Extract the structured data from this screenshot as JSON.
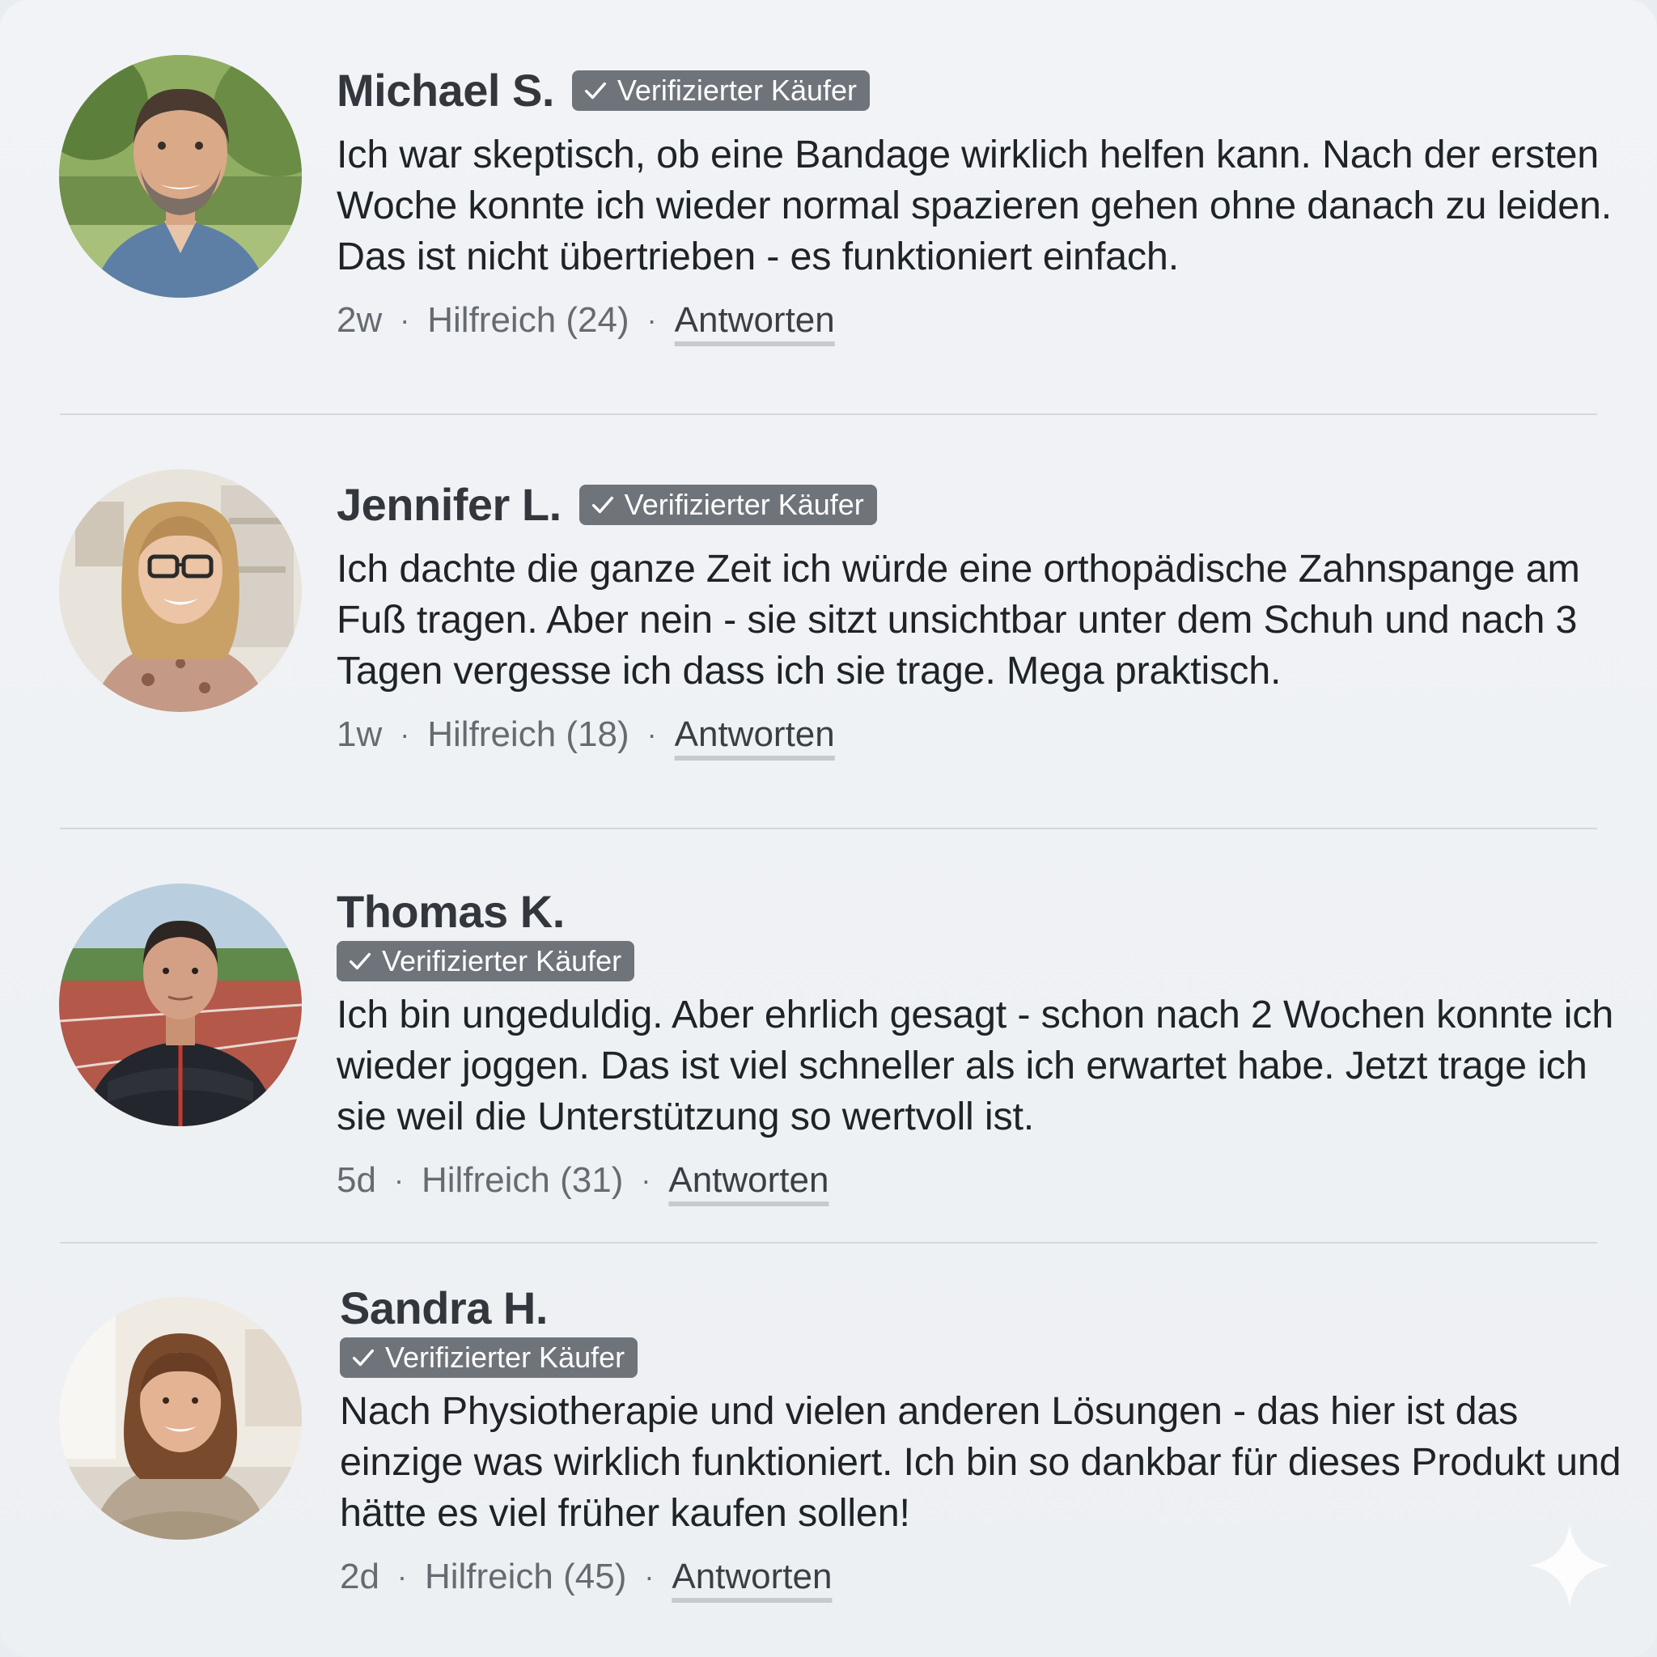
{
  "reviews": [
    {
      "name": "Michael S.",
      "badge": "Verifizierter Käufer",
      "text": "Ich war skeptisch, ob eine Bandage wirklich helfen kann. Nach der ersten Woche konnte ich wieder normal spazieren gehen ohne danach zu leiden. Das ist nicht übertrieben - es funktioniert einfach.",
      "time": "2w",
      "helpful": "Hilfreich (24)",
      "reply": "Antworten"
    },
    {
      "name": "Jennifer L.",
      "badge": "Verifizierter Käufer",
      "text": "Ich dachte die ganze Zeit ich würde eine orthopädische Zahnspange am Fuß tragen. Aber nein - sie sitzt unsichtbar unter dem Schuh und nach 3 Tagen vergesse ich dass ich sie trage. Mega praktisch.",
      "time": "1w",
      "helpful": "Hilfreich (18)",
      "reply": "Antworten"
    },
    {
      "name": "Thomas K.",
      "badge": "Verifizierter Käufer",
      "text": "Ich bin ungeduldig. Aber ehrlich gesagt - schon nach 2 Wochen konnte ich wieder joggen. Das ist viel schneller als ich erwartet habe. Jetzt trage ich sie weil die Unterstützung so wertvoll ist.",
      "time": "5d",
      "helpful": "Hilfreich (31)",
      "reply": "Antworten"
    },
    {
      "name": "Sandra H.",
      "badge": "Verifizierter Käufer",
      "text": "Nach Physiotherapie und vielen anderen Lösungen - das hier ist das einzige was wirklich funktioniert. Ich bin so dankbar für dieses Produkt und hätte es viel früher kaufen sollen!",
      "time": "2d",
      "helpful": "Hilfreich (45)",
      "reply": "Antworten"
    }
  ],
  "meta_separator": "·",
  "icons": {
    "badge_icon": "checkmark-icon",
    "corner_icon": "sparkle-icon"
  },
  "colors": {
    "background": "#eef1f4",
    "badge": "#6f747b",
    "name": "#33373d",
    "text": "#1f2327",
    "meta": "#666b72"
  }
}
